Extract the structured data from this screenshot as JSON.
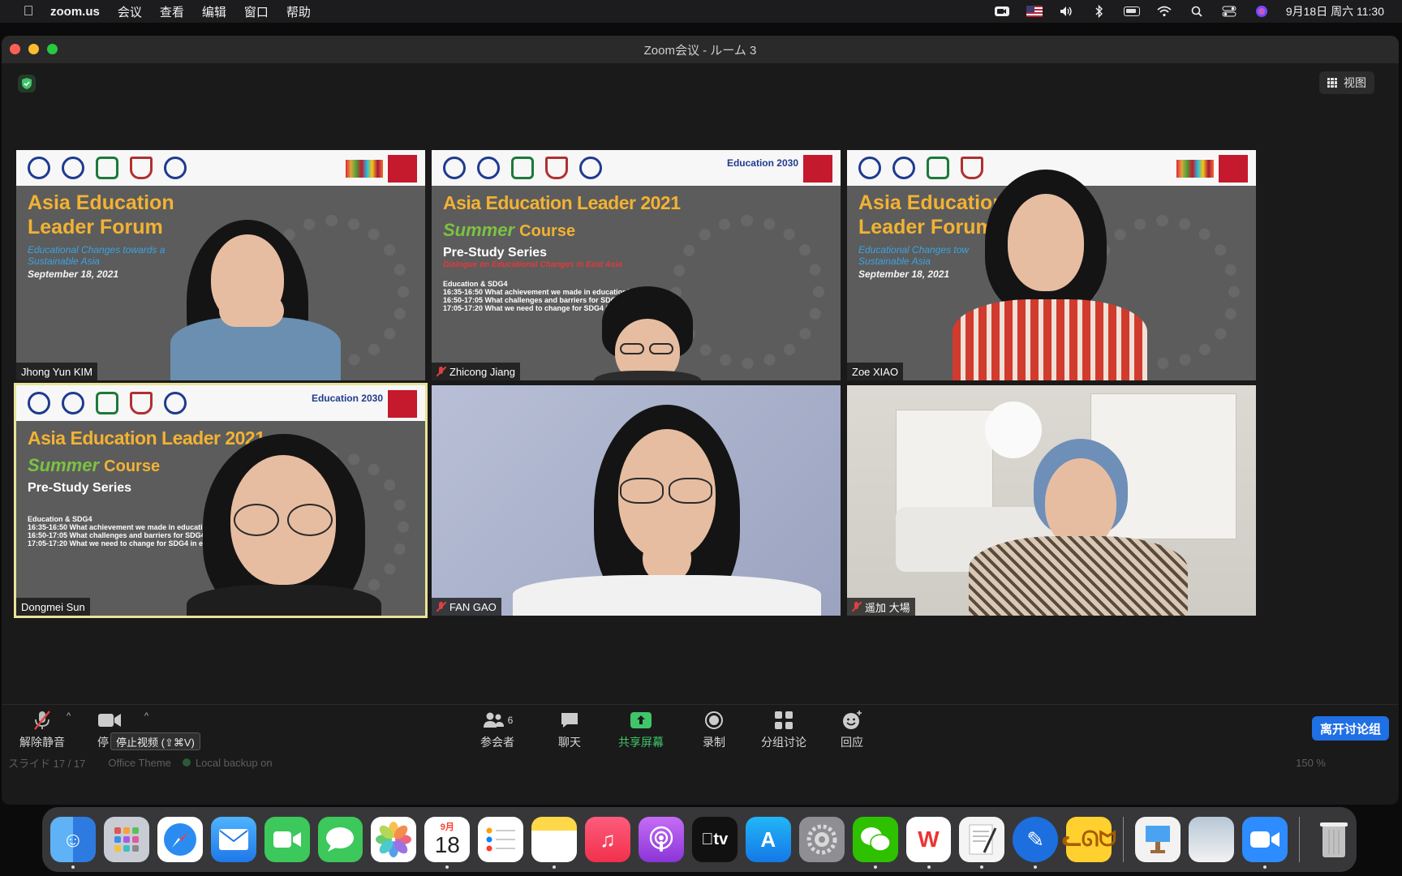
{
  "menubar": {
    "app": "zoom.us",
    "menus": [
      "会议",
      "查看",
      "编辑",
      "窗口",
      "帮助"
    ],
    "datetime": "9月18日 周六  11:30"
  },
  "window": {
    "title": "Zoom会议 - ルーム 3"
  },
  "meeting": {
    "view_label": "视图",
    "tiles": [
      {
        "name": "Jhong Yun KIM",
        "muted": false,
        "slide": {
          "title_line1": "Asia Education",
          "title_line2": "Leader Forum",
          "sub_line1": "Educational Changes towards a",
          "sub_line2": "Sustainable Asia",
          "date": "September 18, 2021"
        }
      },
      {
        "name": "Zhicong Jiang",
        "muted": true,
        "slide": {
          "title": "Asia Education Leader 2021",
          "summer": "Summer",
          "course": "Course",
          "prestudy": "Pre-Study Series",
          "dialogue": "Dialogue on Educational Changes in East Asia",
          "agenda_head": "Education & SDG4",
          "agenda": [
            "16:35-16:50  What achievement we made in education?",
            "16:50-17:05  What challenges and barriers for SDG4 i",
            "17:05-17:20  What we need to change for SDG4 in e"
          ],
          "badge": "Education 2030"
        }
      },
      {
        "name": "Zoe XIAO",
        "muted": false,
        "slide": {
          "title_line1": "Asia Education",
          "title_line2": "Leader Forum",
          "sub_line1": "Educational Changes tow",
          "sub_line2": "Sustainable Asia",
          "date": "September 18, 2021"
        }
      },
      {
        "name": "Dongmei Sun",
        "muted": false,
        "active": true,
        "slide": {
          "title": "Asia Education Leader 2021",
          "summer": "Summer",
          "course": "Course",
          "prestudy": "Pre-Study Series",
          "agenda_head": "Education & SDG4",
          "agenda": [
            "16:35-16:50  What achievement we made in education?",
            "16:50-17:05  What challenges and barriers for SDG4 in",
            "17:05-17:20  What we need to change for SDG4 in educ"
          ],
          "badge": "Education 2030"
        }
      },
      {
        "name": "FAN GAO",
        "muted": true
      },
      {
        "name": "遥加 大場",
        "muted": true
      }
    ]
  },
  "toolbar": {
    "unmute": "解除静音",
    "stop_video_short": "停",
    "tooltip": "停止视频 (⇧⌘V)",
    "participants": "参会者",
    "participants_count": "6",
    "chat": "聊天",
    "share": "共享屏幕",
    "record": "录制",
    "breakout": "分组讨论",
    "reactions": "回应",
    "leave": "离开讨论组"
  },
  "keynote_status": {
    "slide": "スライド 17 / 17",
    "theme": "Office Theme",
    "backup": "Local backup on",
    "zoom": "150 %"
  },
  "dock": {
    "calendar_month": "9月",
    "calendar_day": "18",
    "tv_label": "tv"
  },
  "colors": {
    "accent_blue": "#1f6fe5",
    "share_green": "#3fc56a",
    "active_speaker": "#e9e39a",
    "slide_gold": "#f2b233"
  }
}
